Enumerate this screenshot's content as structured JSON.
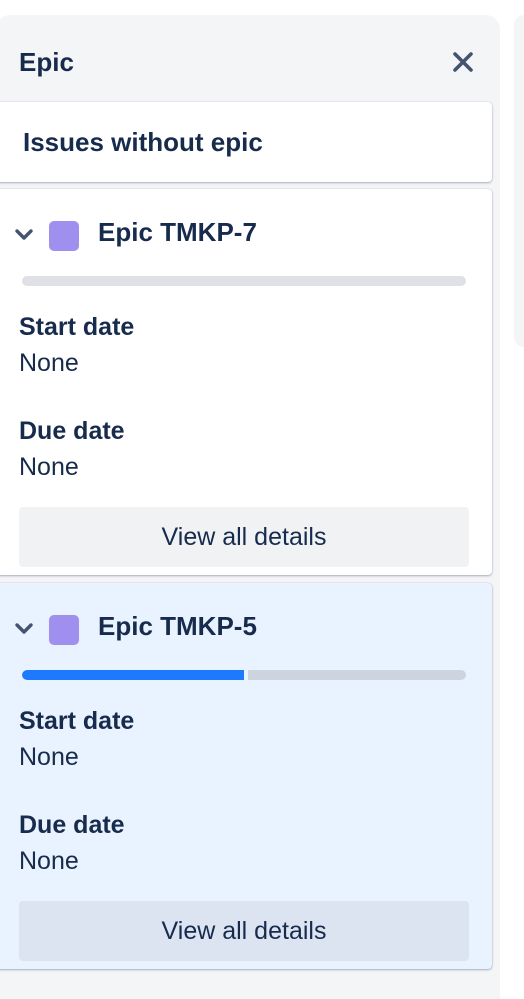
{
  "panel": {
    "title": "Epic",
    "close_icon": "close-icon"
  },
  "no_epic": {
    "label": "Issues without epic"
  },
  "epics": [
    {
      "name": "Epic TMKP-7",
      "color": "#9f8fef",
      "progress": 0,
      "start_date_label": "Start date",
      "start_date_value": "None",
      "due_date_label": "Due date",
      "due_date_value": "None",
      "details_button": "View all details",
      "selected": false
    },
    {
      "name": "Epic TMKP-5",
      "color": "#9f8fef",
      "progress": 0.5,
      "start_date_label": "Start date",
      "start_date_value": "None",
      "due_date_label": "Due date",
      "due_date_value": "None",
      "details_button": "View all details",
      "selected": true
    }
  ],
  "colors": {
    "progress_done": "#1d7afc",
    "selected_background": "#e9f2ff"
  }
}
